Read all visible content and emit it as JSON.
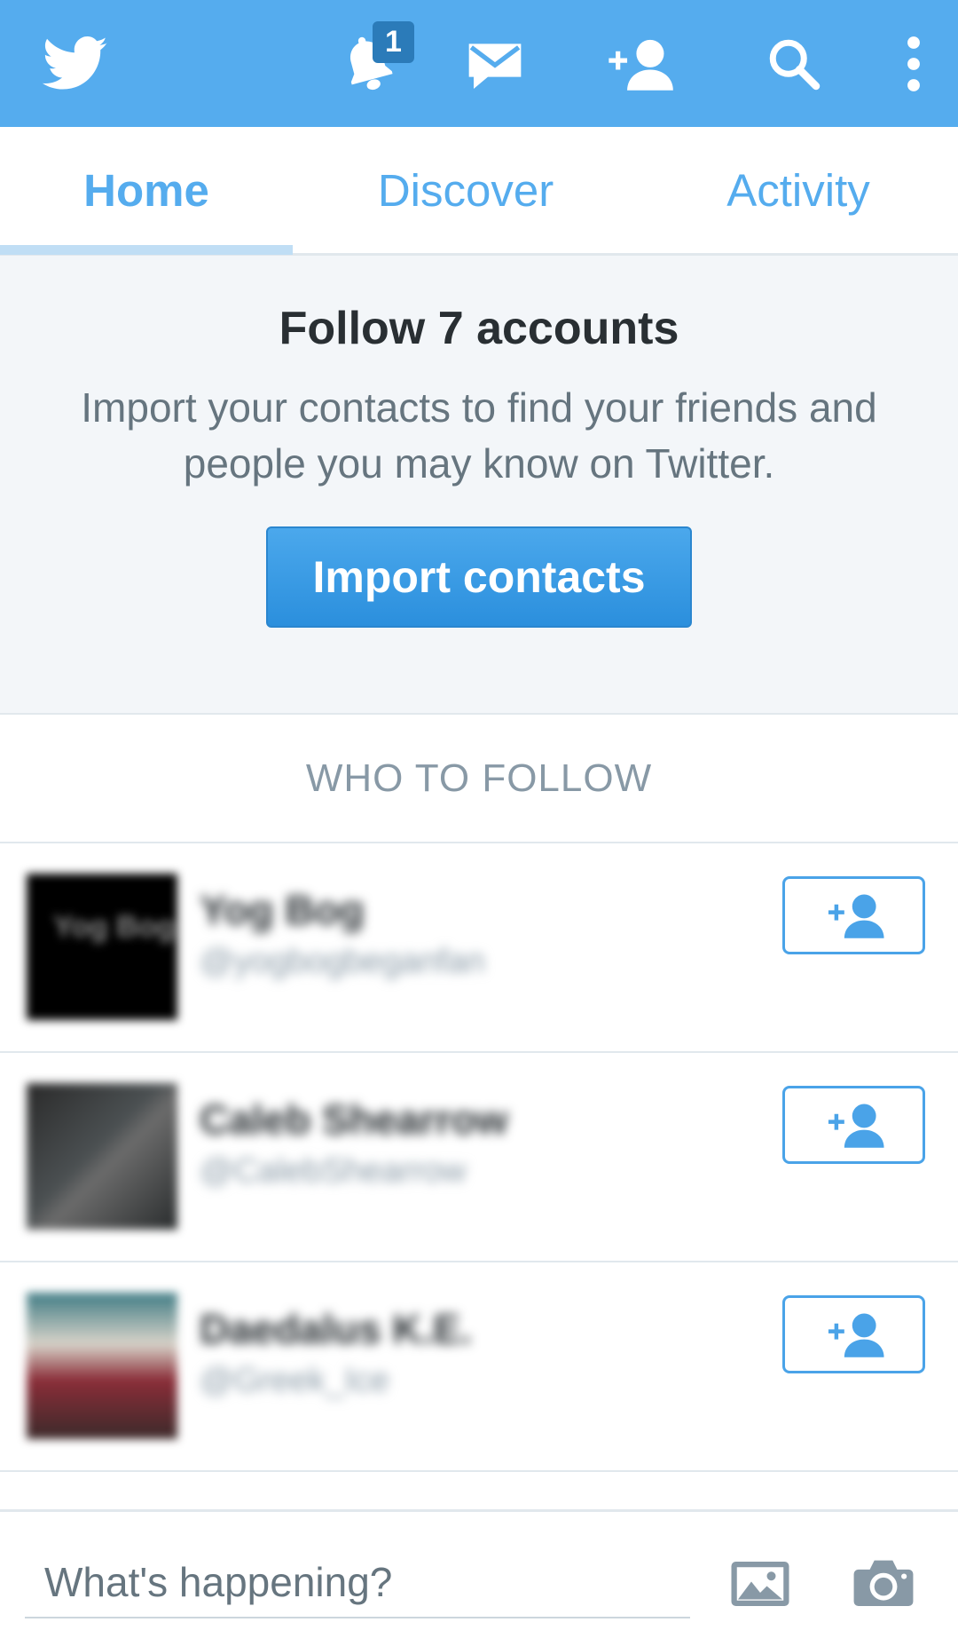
{
  "topbar": {
    "color": "#55acee",
    "icons": {
      "logo": "twitter-bird-icon",
      "notifications": "bell-icon",
      "messages": "envelope-icon",
      "add_user": "add-user-icon",
      "search": "search-icon",
      "more": "overflow-menu-icon"
    },
    "notification_count": "1"
  },
  "tabs": [
    {
      "label": "Home",
      "active": true
    },
    {
      "label": "Discover",
      "active": false
    },
    {
      "label": "Activity",
      "active": false
    }
  ],
  "import_card": {
    "title": "Follow 7 accounts",
    "description": "Import your contacts to find your friends and people you may know on Twitter.",
    "button_label": "Import contacts"
  },
  "who_to_follow": {
    "header": "WHO TO FOLLOW",
    "accounts": [
      {
        "name": "Yog Bog",
        "handle": "@yogbogbeganfan",
        "avatar_text": "Yog Bog"
      },
      {
        "name": "Caleb Shearrow",
        "handle": "@CalebShearrow"
      },
      {
        "name": "Daedalus K.E.",
        "handle": "@Greek_Ice"
      }
    ]
  },
  "compose": {
    "placeholder": "What's happening?",
    "icons": {
      "photo": "photo-icon",
      "camera": "camera-icon"
    }
  }
}
